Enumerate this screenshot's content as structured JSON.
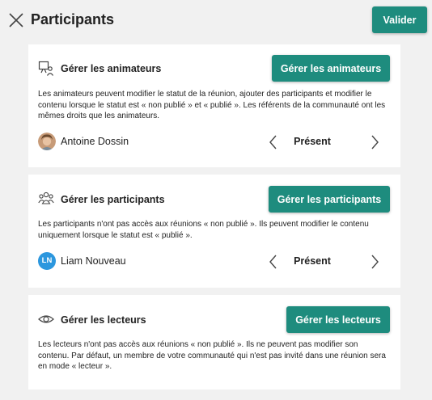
{
  "header": {
    "title": "Participants",
    "validate_label": "Valider",
    "close_icon": "close-icon"
  },
  "cards": [
    {
      "icon": "presenter-icon",
      "title": "Gérer les animateurs",
      "button_label": "Gérer les animateurs",
      "description": "Les animateurs peuvent modifier le statut de la réunion, ajouter des participants et modifier le contenu lorsque le statut est « non publié » et « publié ». Les référents de la communauté ont les mêmes droits que les animateurs.",
      "person": {
        "name": "Antoine Dossin",
        "status": "Présent",
        "avatar": "photo"
      }
    },
    {
      "icon": "group-icon",
      "title": "Gérer les participants",
      "button_label": "Gérer les participants",
      "description": "Les participants n'ont pas accès aux réunions « non publié ». Ils peuvent modifier le contenu uniquement lorsque le statut est « publié ».",
      "person": {
        "name": "Liam Nouveau",
        "status": "Présent",
        "initials": "LN"
      }
    },
    {
      "icon": "eye-icon",
      "title": "Gérer les lecteurs",
      "button_label": "Gérer les lecteurs",
      "description": "Les lecteurs n'ont pas accès aux réunions « non publié ». Ils ne peuvent pas modifier son contenu. Par défaut, un membre de votre communauté qui n'est pas invité dans une réunion sera en mode « lecteur »."
    }
  ],
  "colors": {
    "accent": "#1e8c7e",
    "background": "#f1f1f1",
    "card": "#ffffff",
    "avatar_initials_bg": "#2c97de"
  }
}
